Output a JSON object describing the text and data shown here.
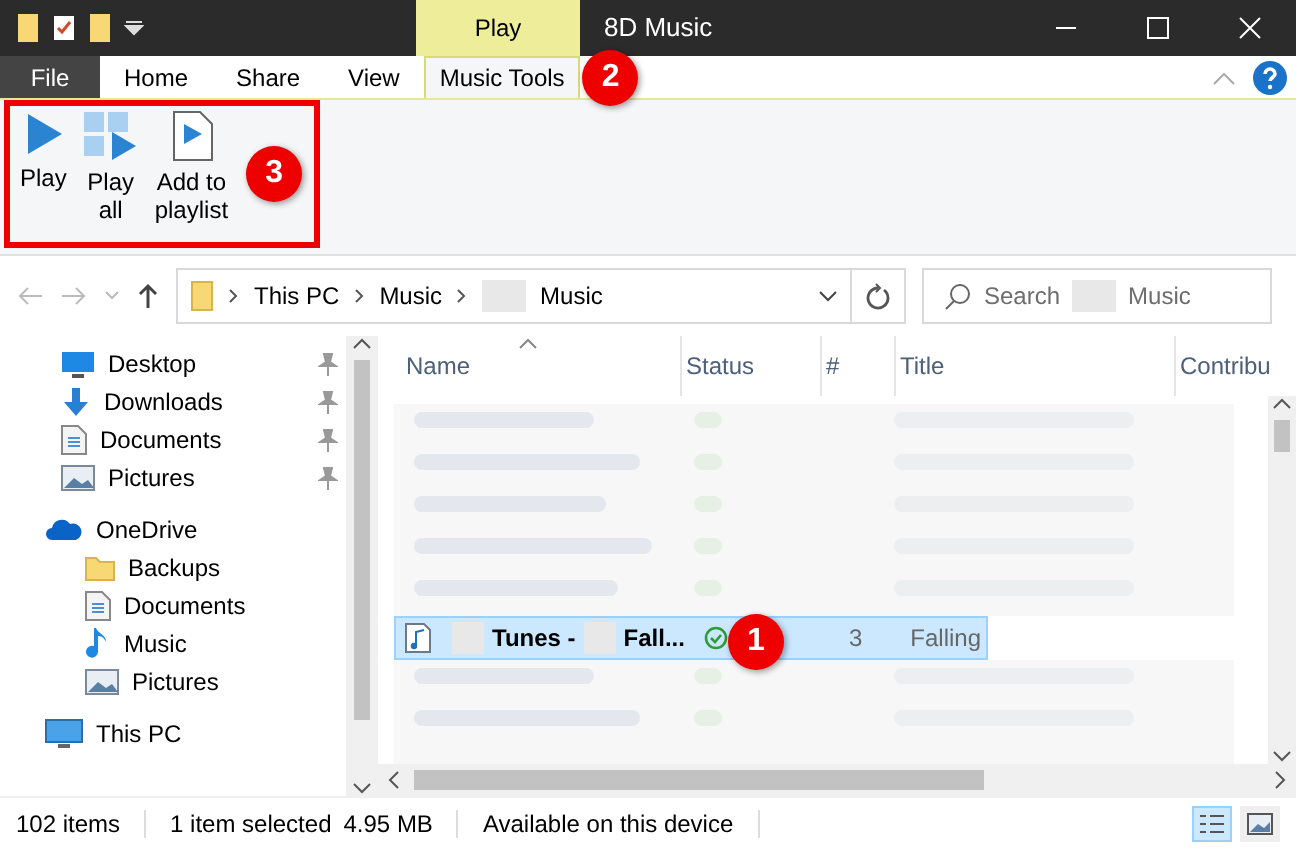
{
  "window": {
    "title": "8D Music",
    "context_tab": "Play"
  },
  "ribbon_tabs": [
    {
      "label": "File",
      "kind": "file",
      "selected": false
    },
    {
      "label": "Home",
      "kind": "tab",
      "selected": false
    },
    {
      "label": "Share",
      "kind": "tab",
      "selected": false
    },
    {
      "label": "View",
      "kind": "tab",
      "selected": false
    },
    {
      "label": "Music Tools",
      "kind": "tab",
      "selected": true
    }
  ],
  "ribbon_buttons": [
    {
      "label": "Play",
      "kind": "play"
    },
    {
      "label": "Play\nall",
      "kind": "play-all"
    },
    {
      "label": "Add to\nplaylist",
      "kind": "playlist"
    }
  ],
  "address": {
    "path": [
      {
        "label": "This PC",
        "redacted": false
      },
      {
        "label": "Music",
        "redacted": false
      },
      {
        "label": "Music",
        "redacted": true
      }
    ]
  },
  "search": {
    "label": "Search",
    "scope": "Music"
  },
  "nav": [
    {
      "label": "Desktop",
      "kind": "desktop",
      "pinned": true
    },
    {
      "label": "Downloads",
      "kind": "downloads",
      "pinned": true
    },
    {
      "label": "Documents",
      "kind": "documents",
      "pinned": true
    },
    {
      "label": "Pictures",
      "kind": "pictures",
      "pinned": true
    },
    {
      "label": "OneDrive",
      "kind": "onedrive",
      "pinned": false,
      "children": [
        {
          "label": "Backups",
          "kind": "folder",
          "pinned": false
        },
        {
          "label": "Documents",
          "kind": "documents",
          "pinned": false
        },
        {
          "label": "Music",
          "kind": "music",
          "pinned": false
        },
        {
          "label": "Pictures",
          "kind": "pictures",
          "pinned": false
        }
      ]
    },
    {
      "label": "This PC",
      "kind": "pc",
      "pinned": false
    }
  ],
  "columns": [
    {
      "label": "Name",
      "sorted": true
    },
    {
      "label": "Status",
      "sorted": false
    },
    {
      "label": "#",
      "sorted": false
    },
    {
      "label": "Title",
      "sorted": false
    },
    {
      "label": "Contribu",
      "sorted": false
    }
  ],
  "selected_row": {
    "name_start": "Tunes -",
    "name_end": "Fall...",
    "synced": true,
    "number": "3",
    "title": "Falling",
    "selected": true
  },
  "callouts": [
    {
      "label": "2"
    },
    {
      "label": "3"
    },
    {
      "label": "1"
    }
  ],
  "status_bar": {
    "items": "102 items",
    "selection": "1 item selected",
    "size": "4.95 MB",
    "availability": "Available on this device"
  },
  "views": [
    {
      "kind": "details",
      "selected": true
    },
    {
      "kind": "tiles",
      "selected": false
    }
  ]
}
